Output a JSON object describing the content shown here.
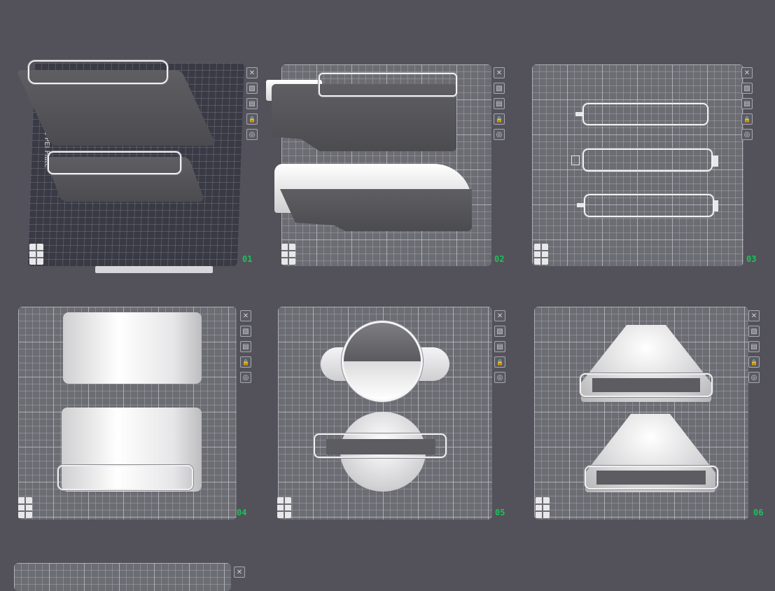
{
  "plates": [
    {
      "number": "01",
      "active": true,
      "bed_label": "Textured PEI Plate"
    },
    {
      "number": "02",
      "active": false
    },
    {
      "number": "03",
      "active": false
    },
    {
      "number": "04",
      "active": false
    },
    {
      "number": "05",
      "active": false
    },
    {
      "number": "06",
      "active": false
    },
    {
      "number": "",
      "active": false
    }
  ],
  "toolbar": {
    "icons": [
      "close-icon",
      "arrange-icon",
      "plate-settings-icon",
      "lock-icon",
      "slice-icon"
    ],
    "glyphs": {
      "close": "✕",
      "arrange": "▧",
      "settings": "▤",
      "lock": "🔒",
      "slice": "◎"
    }
  },
  "colors": {
    "plate_number": "#1ec05a",
    "background": "#53525a"
  }
}
